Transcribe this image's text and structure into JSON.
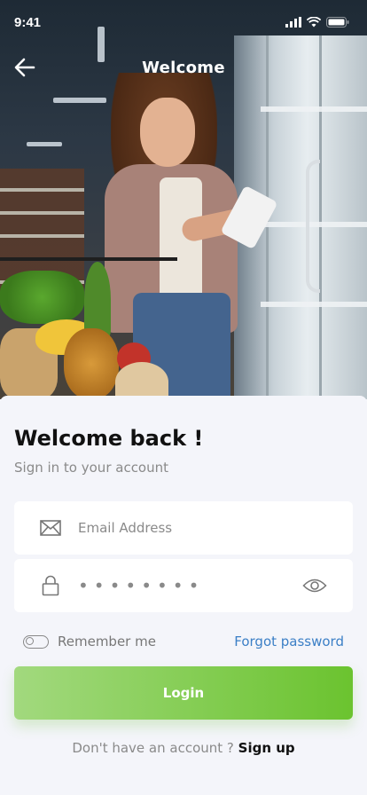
{
  "status_bar": {
    "time": "9:41"
  },
  "nav": {
    "title": "Welcome"
  },
  "login": {
    "heading": "Welcome back !",
    "subheading": "Sign in to your account",
    "email_placeholder": "Email Address",
    "password_mask": "••••••••",
    "remember_label": "Remember me",
    "forgot_label": "Forgot password",
    "login_label": "Login",
    "signup_question": "Don't have an account ? ",
    "signup_label": "Sign up"
  },
  "icons": {
    "back": "back-arrow-icon",
    "email": "envelope-icon",
    "password": "lock-icon",
    "show_password": "eye-icon",
    "signal": "signal-icon",
    "wifi": "wifi-icon",
    "battery": "battery-icon"
  },
  "colors": {
    "accent_green_start": "#a2d97e",
    "accent_green_end": "#6bc32f",
    "link_blue": "#3b7fc6",
    "background": "#f4f5fa"
  }
}
